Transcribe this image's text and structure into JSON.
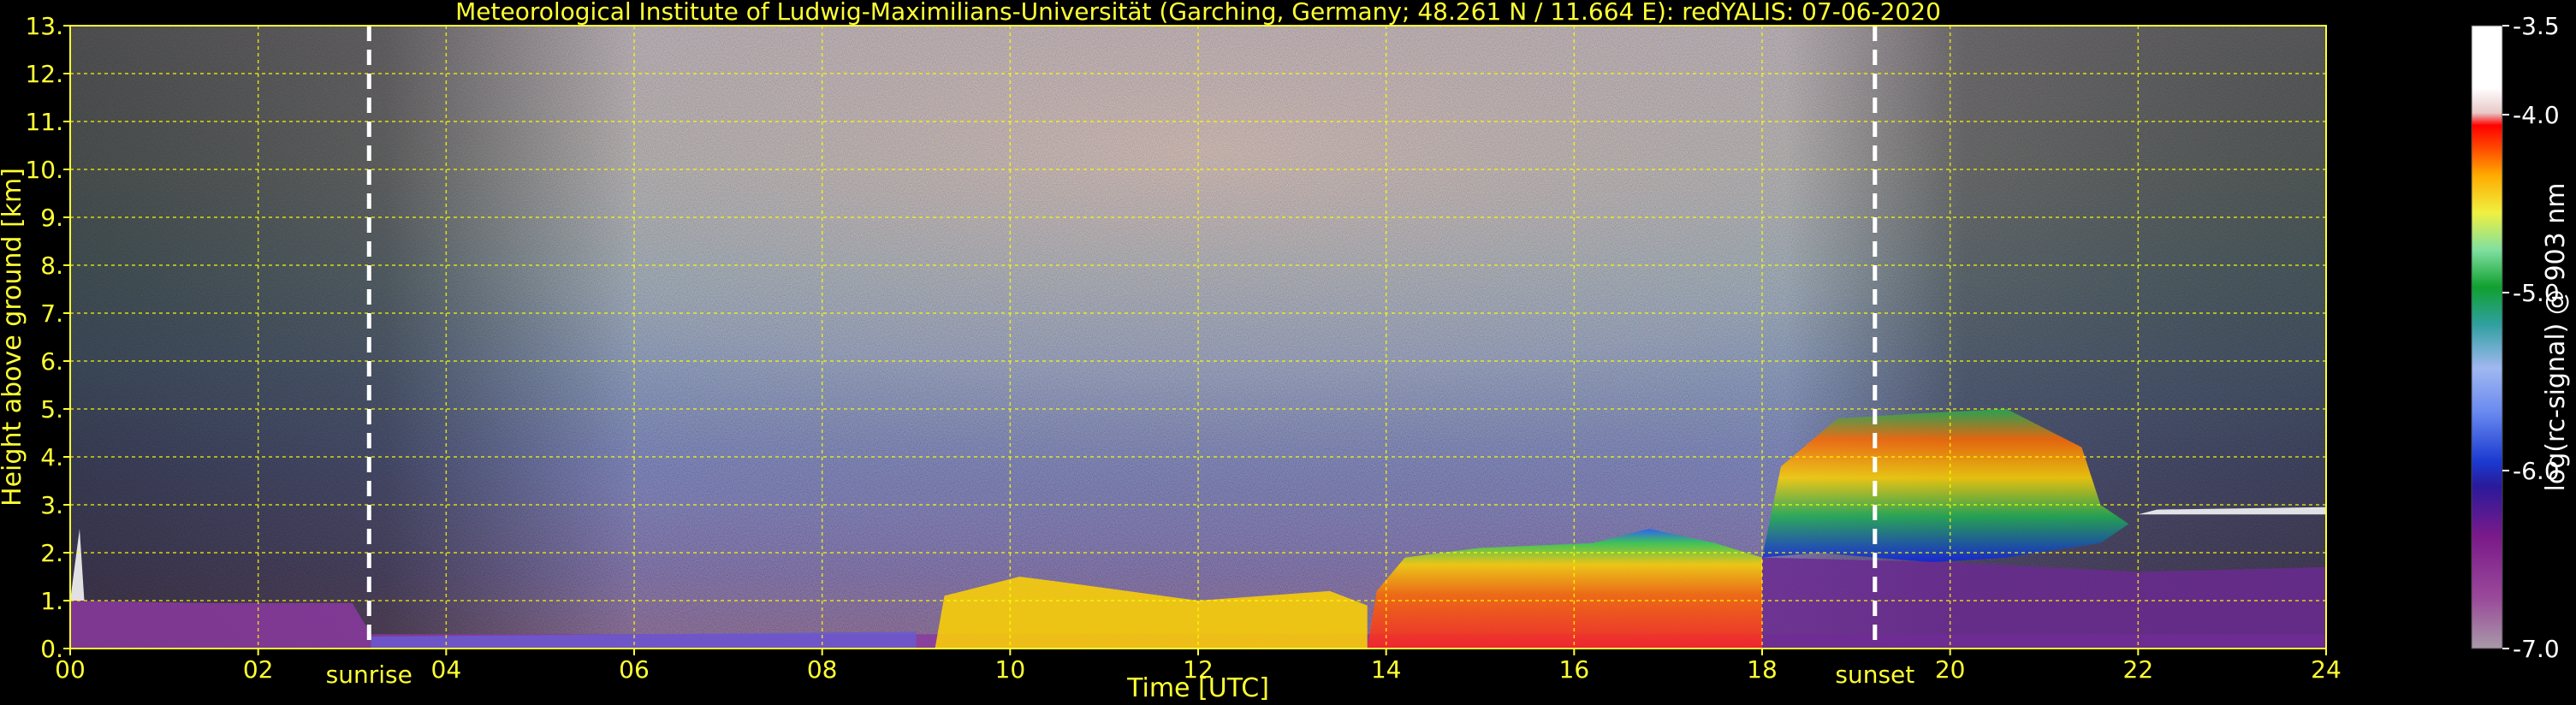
{
  "chart_data": {
    "type": "heatmap",
    "title": "Meteorological Institute of Ludwig-Maximilians-Universität (Garching, Germany; 48.261 N / 11.664 E):    redYALIS: 07-06-2020",
    "xlabel": "Time [UTC]",
    "ylabel": "Height above ground [km]",
    "xlim": [
      0,
      24
    ],
    "ylim": [
      0,
      13
    ],
    "x_ticks": [
      0,
      2,
      4,
      6,
      8,
      10,
      12,
      14,
      16,
      18,
      20,
      22,
      24
    ],
    "x_tick_labels": [
      "00",
      "02",
      "04",
      "06",
      "08",
      "10",
      "12",
      "14",
      "16",
      "18",
      "20",
      "22",
      "24"
    ],
    "y_ticks": [
      0,
      1,
      2,
      3,
      4,
      5,
      6,
      7,
      8,
      9,
      10,
      11,
      12,
      13
    ],
    "y_tick_labels": [
      "0.",
      "1.",
      "2.",
      "3.",
      "4.",
      "5.",
      "6.",
      "7.",
      "8.",
      "9.",
      "10.",
      "11.",
      "12.",
      "13."
    ],
    "grid": true,
    "colorbar": {
      "label": "log(rc-signal) @ 903 nm",
      "range": [
        -7.0,
        -3.5
      ],
      "ticks": [
        -3.5,
        -4.0,
        -5.0,
        -6.0,
        -7.0
      ],
      "tick_labels": [
        "-3.5",
        "-4.0",
        "-5.0",
        "-6.0",
        "-7.0"
      ]
    },
    "markers": [
      {
        "name": "sunrise",
        "label": "sunrise",
        "time": 3.18
      },
      {
        "name": "sunset",
        "label": "sunset",
        "time": 19.2
      }
    ],
    "colors": {
      "background": "#000000",
      "text": "#ffff33",
      "grid": "#ffff00",
      "marker_line": "#ffffff"
    }
  }
}
